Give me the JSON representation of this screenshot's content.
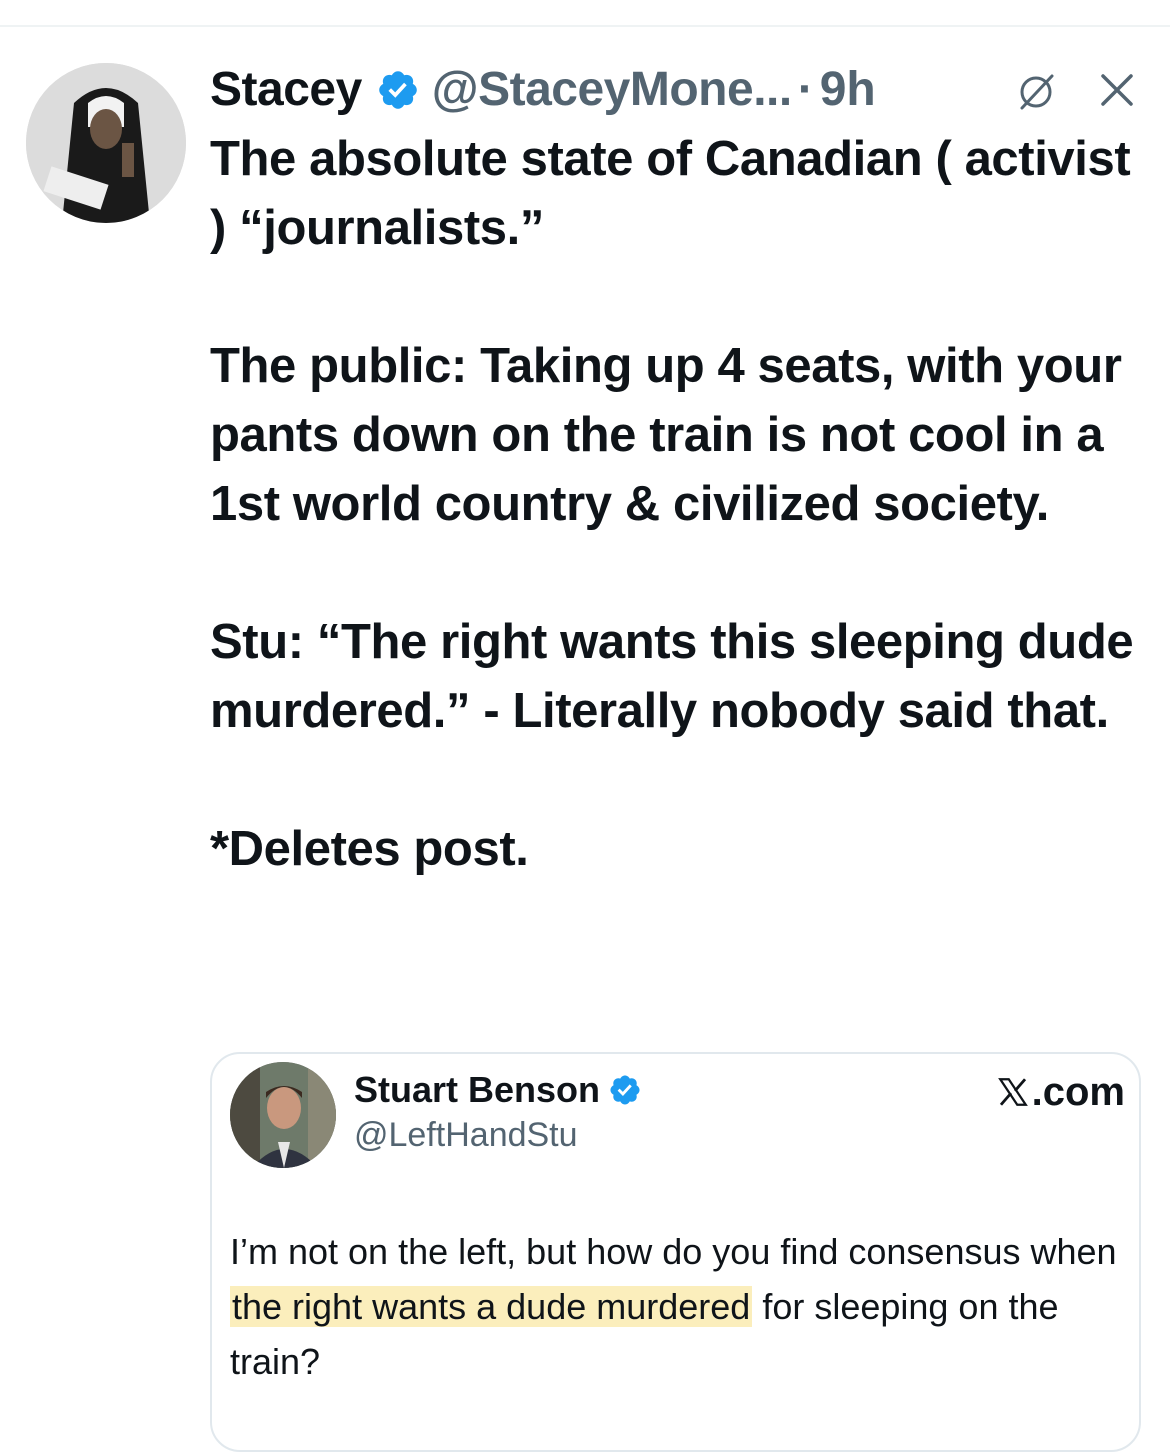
{
  "tweet": {
    "author": {
      "display_name": "Stacey",
      "handle": "@StaceyMone...",
      "verified": true
    },
    "separator": "·",
    "time": "9h",
    "icons": [
      "mute-icon",
      "close-icon",
      "verified-badge-icon"
    ],
    "paragraphs": [
      "The absolute state of Canadian ( activist ) “journalists.”",
      "The public: Taking up 4 seats, with your pants down on the train is not cool in a 1st world country & civilized society.",
      "Stu: “The right wants this sleeping dude murdered.” - Literally nobody said that.",
      "*Deletes post."
    ]
  },
  "quoted_post": {
    "display_name": "Stuart Benson",
    "handle": "@LeftHandStu",
    "verified": true,
    "brand": ".com",
    "text_before": "I’m not on the left, but how do you find consensus when ",
    "text_highlight": "the right wants a dude murdered",
    "text_after": " for sleeping on the train?"
  },
  "colors": {
    "text_primary": "#0f1419",
    "text_secondary": "#536471",
    "verified_blue": "#1d9bf0",
    "highlight": "#fbeebc",
    "card_border": "#e1e8ed"
  }
}
